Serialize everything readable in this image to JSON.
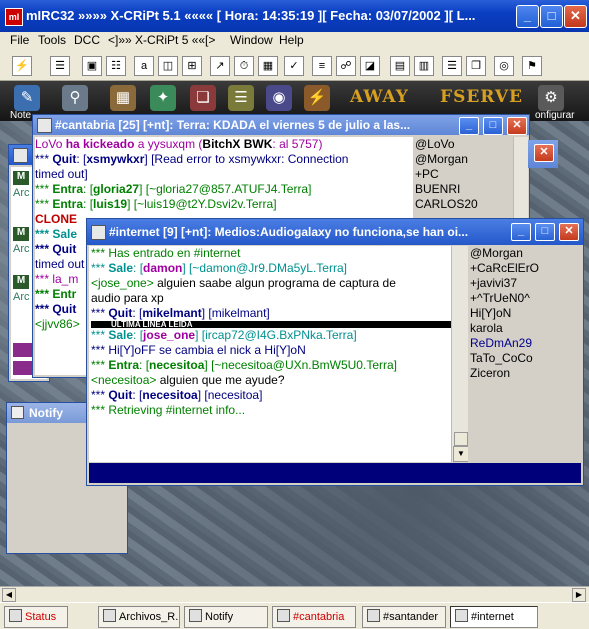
{
  "app": {
    "title": "mIRC32 »»»» X-CRiPt 5.1 «««« [ Hora: 14:35:19 ][ Fecha: 03/07/2002 ][ L...",
    "icon_text": "mI"
  },
  "menu": [
    "File",
    "Tools",
    "DCC",
    "<]»» X-CRiPt 5 ««[>",
    "Window",
    "Help"
  ],
  "scriptbar": {
    "labels": {
      "notes": "Note",
      "config": "onfigurar"
    },
    "away": "AWAY",
    "fserve": "FSERVE"
  },
  "cantabria": {
    "title": "#cantabria [25] [+nt]: Terra: KDADA el viernes 5 de julio a las...",
    "lines": [
      {
        "parts": [
          {
            "t": "LoVo ",
            "c": "mag"
          },
          {
            "t": "ha kickeado",
            "c": "mag",
            "b": true
          },
          {
            "t": " a yysuxqm (",
            "c": "mag"
          },
          {
            "t": "BitchX BWK",
            "c": "",
            "b": true
          },
          {
            "t": ": al 5757)",
            "c": "mag"
          }
        ]
      },
      {
        "parts": [
          {
            "t": "*** ",
            "c": "navy"
          },
          {
            "t": "Quit",
            "c": "navy",
            "b": true
          },
          {
            "t": ": [",
            "c": "navy"
          },
          {
            "t": "xsmywkxr",
            "c": "navy",
            "b": true
          },
          {
            "t": "] [Read error to xsmywkxr: Connection",
            "c": "navy"
          }
        ]
      },
      {
        "parts": [
          {
            "t": "timed out]",
            "c": "navy"
          }
        ]
      },
      {
        "parts": [
          {
            "t": "*** ",
            "c": "green"
          },
          {
            "t": "Entra",
            "c": "green",
            "b": true
          },
          {
            "t": ": [",
            "c": "green"
          },
          {
            "t": "gloria27",
            "c": "green",
            "b": true
          },
          {
            "t": "] [~gloria27@857.ATUFJ4.Terra]",
            "c": "green"
          }
        ]
      },
      {
        "parts": [
          {
            "t": "*** ",
            "c": "green"
          },
          {
            "t": "Entra",
            "c": "green",
            "b": true
          },
          {
            "t": ": [",
            "c": "green"
          },
          {
            "t": "luis19",
            "c": "green",
            "b": true
          },
          {
            "t": "] [~luis19@t2Y.Dsvi2v.Terra]",
            "c": "green"
          }
        ]
      },
      {
        "parts": [
          {
            "t": "CLONE",
            "c": "red",
            "b": true
          }
        ]
      },
      {
        "parts": [
          {
            "t": "*** Sale",
            "c": "teal",
            "b": true
          }
        ]
      },
      {
        "parts": [
          {
            "t": "*** Quit",
            "c": "navy",
            "b": true
          }
        ]
      },
      {
        "parts": [
          {
            "t": "timed out",
            "c": "navy"
          }
        ]
      },
      {
        "parts": [
          {
            "t": "*** la_m",
            "c": "mag"
          }
        ]
      },
      {
        "parts": [
          {
            "t": "*** Entr",
            "c": "green",
            "b": true
          }
        ]
      },
      {
        "parts": [
          {
            "t": "*** Quit",
            "c": "navy",
            "b": true
          }
        ]
      },
      {
        "parts": [
          {
            "t": "<jjvv86>",
            "c": "green"
          }
        ]
      }
    ],
    "nicks": [
      "@LoVo",
      "@Morgan",
      "+PC",
      "BUENRI",
      "CARLOS20"
    ]
  },
  "internet": {
    "title": "#internet [9] [+nt]: Medios:Audiogalaxy no funciona,se han oi...",
    "lines": [
      {
        "parts": [
          {
            "t": "*** Has entrado en #internet",
            "c": "green"
          }
        ]
      },
      {
        "parts": [
          {
            "t": "*** ",
            "c": "teal"
          },
          {
            "t": "Sale",
            "c": "teal",
            "b": true
          },
          {
            "t": ": [",
            "c": "teal"
          },
          {
            "t": "damon",
            "c": "mag",
            "b": true
          },
          {
            "t": "] [~damon@Jr9.DMa5yL.Terra]",
            "c": "teal"
          }
        ]
      },
      {
        "parts": [
          {
            "t": "<jose_one>",
            "c": "green"
          },
          {
            "t": " alguien saabe algun programa de captura de",
            "c": ""
          }
        ]
      },
      {
        "parts": [
          {
            "t": "audio para xp",
            "c": ""
          }
        ]
      },
      {
        "parts": [
          {
            "t": "*** ",
            "c": "navy"
          },
          {
            "t": "Quit",
            "c": "navy",
            "b": true
          },
          {
            "t": ": [",
            "c": "navy"
          },
          {
            "t": "mikelmant",
            "c": "navy",
            "b": true
          },
          {
            "t": "] [mikelmant]",
            "c": "navy"
          }
        ]
      },
      {
        "sep": "ULTIMA LINEA LEIDA"
      },
      {
        "parts": [
          {
            "t": "*** ",
            "c": "teal"
          },
          {
            "t": "Sale",
            "c": "teal",
            "b": true
          },
          {
            "t": ": [",
            "c": "teal"
          },
          {
            "t": "jose_one",
            "c": "mag",
            "b": true
          },
          {
            "t": "] [ircap72@I4G.BxPNka.Terra]",
            "c": "teal"
          }
        ]
      },
      {
        "parts": [
          {
            "t": "*** Hi[Y]oFF se cambia el nick a Hi[Y]oN",
            "c": "navy"
          }
        ]
      },
      {
        "parts": [
          {
            "t": "*** ",
            "c": "green"
          },
          {
            "t": "Entra",
            "c": "green",
            "b": true
          },
          {
            "t": ": [",
            "c": "green"
          },
          {
            "t": "necesitoa",
            "c": "green",
            "b": true
          },
          {
            "t": "] [~necesitoa@UXn.BmW5U0.Terra]",
            "c": "green"
          }
        ]
      },
      {
        "parts": [
          {
            "t": "<necesitoa>",
            "c": "green"
          },
          {
            "t": " alguien que me ayude?",
            "c": ""
          }
        ]
      },
      {
        "parts": [
          {
            "t": "*** ",
            "c": "navy"
          },
          {
            "t": "Quit",
            "c": "navy",
            "b": true
          },
          {
            "t": ": [",
            "c": "navy"
          },
          {
            "t": "necesitoa",
            "c": "navy",
            "b": true
          },
          {
            "t": "] [necesitoa]",
            "c": "navy"
          }
        ]
      },
      {
        "parts": [
          {
            "t": "*** Retrieving #internet info...",
            "c": "green"
          }
        ]
      }
    ],
    "nicks": [
      {
        "n": "@Morgan",
        "c": ""
      },
      {
        "n": "+CaRcElErO",
        "c": ""
      },
      {
        "n": "+javivi37",
        "c": ""
      },
      {
        "n": "+^TrUeN0^",
        "c": ""
      },
      {
        "n": "Hi[Y]oN",
        "c": ""
      },
      {
        "n": "karola",
        "c": ""
      },
      {
        "n": "ReDmAn29",
        "c": "blue"
      },
      {
        "n": "TaTo_CoCo",
        "c": ""
      },
      {
        "n": "Ziceron",
        "c": ""
      }
    ]
  },
  "left_windows": {
    "labels": [
      "Arc",
      "Arc",
      "Arc"
    ],
    "notify_title": "Notify"
  },
  "switchbar": [
    {
      "label": "Status",
      "c": "red"
    },
    {
      "label": "Archivos_R...",
      "c": ""
    },
    {
      "label": "Notify",
      "c": ""
    },
    {
      "label": "#cantabria",
      "c": "red"
    },
    {
      "label": "#santander",
      "c": ""
    },
    {
      "label": "#internet",
      "c": ""
    }
  ],
  "colors": {
    "title_blue": "#0a3ec2",
    "input_navy": "#00007b",
    "teal": "#009090",
    "magenta": "#a000a0"
  }
}
